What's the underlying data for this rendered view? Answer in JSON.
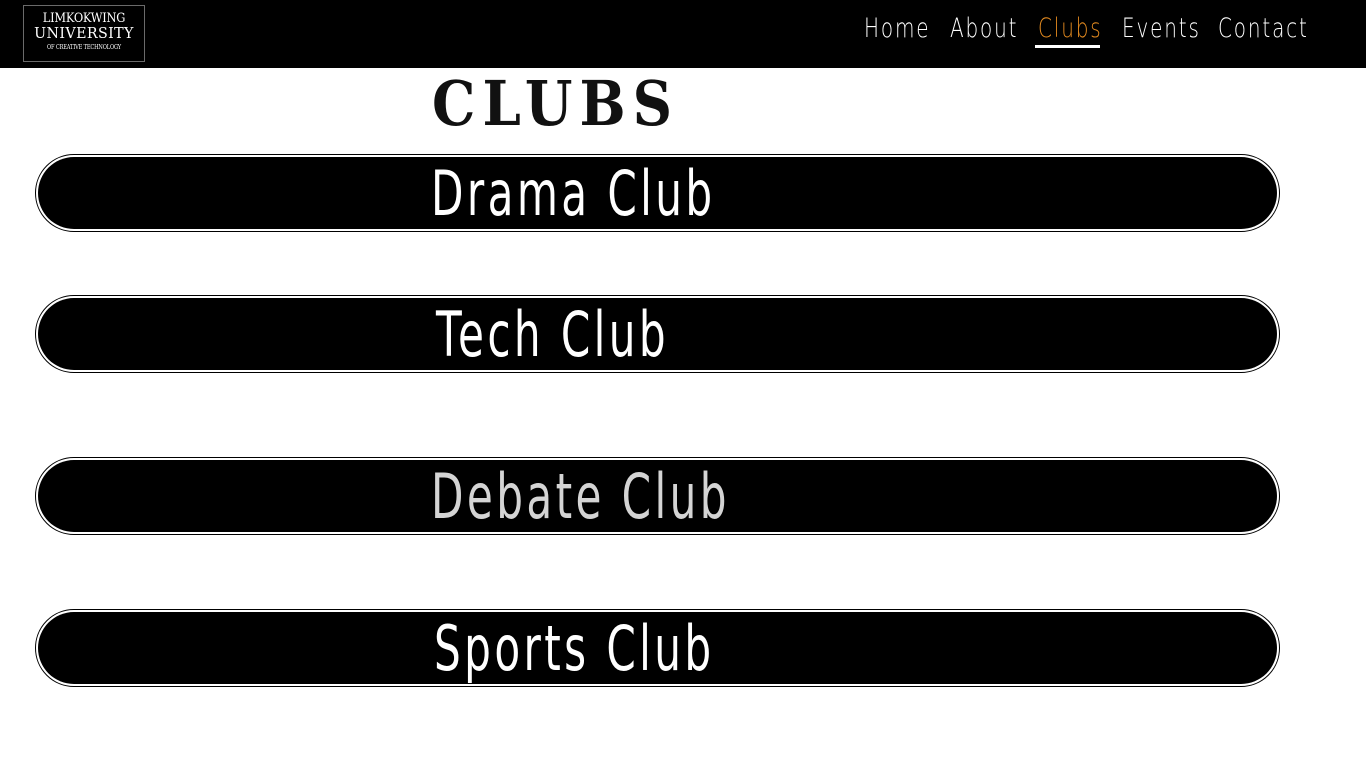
{
  "header": {
    "logo": {
      "line1": "LIMKOKWING",
      "line2": "UNIVERSITY",
      "line3": "OF CREATIVE TECHNOLOGY"
    },
    "nav": [
      {
        "label": "Home",
        "active": false
      },
      {
        "label": "About",
        "active": false
      },
      {
        "label": "Clubs",
        "active": true
      },
      {
        "label": "Events",
        "active": false
      },
      {
        "label": "Contact",
        "active": false
      }
    ],
    "active_color": "#e38a1f"
  },
  "page": {
    "title": "CLUBS"
  },
  "clubs": [
    {
      "label": "Drama Club"
    },
    {
      "label": "Tech Club"
    },
    {
      "label": "Debate Club"
    },
    {
      "label": "Sports Club"
    }
  ]
}
